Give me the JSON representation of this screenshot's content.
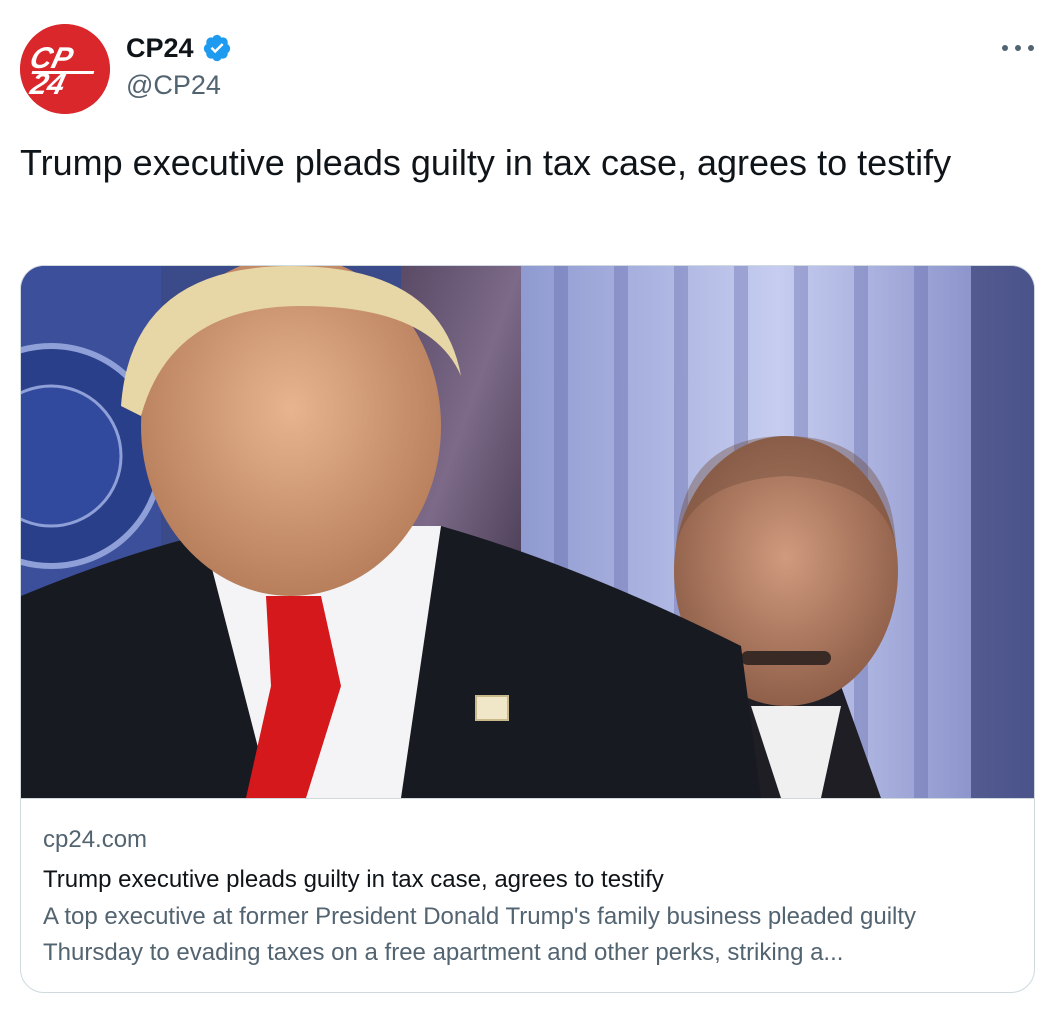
{
  "author": {
    "display_name": "CP24",
    "handle": "@CP24",
    "verified": true,
    "avatar_text_top": "CP",
    "avatar_text_bottom": "24",
    "avatar_color": "#d9272b"
  },
  "tweet": {
    "text": "Trump executive pleads guilty in tax case, agrees to testify"
  },
  "card": {
    "image_icon": "news-photo",
    "domain": "cp24.com",
    "title": "Trump executive pleads guilty in tax case, agrees to testify",
    "description": "A top executive at former President Donald Trump's family business pleaded guilty Thursday to evading taxes on a free apartment and other perks, striking a..."
  },
  "colors": {
    "text_primary": "#0f1419",
    "text_secondary": "#536471",
    "border": "#cfd9de",
    "verified_blue": "#1d9bf0"
  },
  "icons": {
    "more": "more-horizontal-icon",
    "verified": "verified-badge-icon"
  }
}
